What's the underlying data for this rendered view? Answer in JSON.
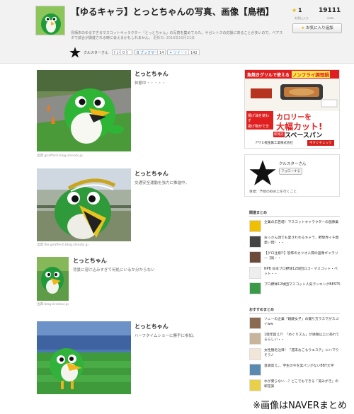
{
  "header": {
    "title": "【ゆるキャラ】とっとちゃんの写真、画像【鳥栖】",
    "description": "鳥栖市のゆるすぎるマスコットキャラクター「とっとちゃん」の写真を集めてみた。サガントスの応援に来ることが多いので、ベアスタで試合が開催される時に会えるかもしれません。",
    "updated": "更新日: 2016年10月21日",
    "author": "クルスターさん",
    "like_label": "いいね！",
    "like_count": "0",
    "hatena_label": "B",
    "hatena_count": "14",
    "tweet_label": "ツイート",
    "tweet_count": "142"
  },
  "favorites": {
    "star": "★",
    "count": "1",
    "count_label": "お気に入り",
    "views": "19111",
    "views_label": "view",
    "button_label": "お気に入り追加"
  },
  "entries": [
    {
      "title": "とっとちゃん",
      "desc": "休憩中・・・・・",
      "source": "出典 giraffech.blog.shinobi.jp"
    },
    {
      "title": "とっとちゃん",
      "desc": "交通安全運動を強力に推進中。",
      "source": "出典 file.giraffech.blog.shinobi.jp"
    },
    {
      "title": "とっとちゃん",
      "desc": "背景に溶け込みすぎて何処にいるか分からない",
      "source": "出典 blog.livedoor.jp"
    },
    {
      "title": "とっとちゃん",
      "desc": "ハーフタイムショーに勝手に参加。",
      "source": ""
    }
  ],
  "ad": {
    "headline": "魚焼きグリルで使える",
    "headline_highlight": "ノンフライ調理鍋",
    "callout1": "揚げ油を使わず",
    "callout2": "揚げ物ができる",
    "big1": "カロリーを",
    "big2": "大幅カット!",
    "badge": "新発売",
    "brand": "スベースパン",
    "company": "アサヒ軽金属工業株式会社",
    "cta": "今すぐチェック"
  },
  "curator": {
    "name": "クルスターさん",
    "button": "フォローする",
    "tagline": "目標：予想の斜め上を行くこと"
  },
  "related": {
    "heading": "関連まとめ",
    "items": [
      "企業の広告塔！マスコットキャラクターの画像集",
      "おっさん顔でも愛されゆるキャラ、野球界イチ無愛い団！・・",
      "【グロ注意!!】恐怖のカツオ人間の画像ギャラリー【鳥・・",
      "NPB 日本プロ野球12球団ロゴ・マスコット・ペット・・",
      "プロ野球12球団マスコット人気ランキングBEST5"
    ]
  },
  "recommended": {
    "heading": "おすすめまとめ",
    "items": [
      "ソニーの企業「跳躍女子」の撮り方ラスマがスゴイww",
      "1億年超え?！「めぐりズム」が感傷以上に売れてるらしい・・",
      "女性脱毛注目！「週末おこもりエステ」にハマりそう♪",
      "意識高え。。学生の今を実パンがないBBT大学",
      "水が要らない…？どこでもできる「湯みがき」の新提案"
    ]
  },
  "watermark": "※画像はNAVERまとめ",
  "colors": {
    "accent_green": "#39a845",
    "ad_red": "#e02020",
    "ad_yellow": "#ffe34a",
    "tweet_blue": "#4b9ad8"
  }
}
